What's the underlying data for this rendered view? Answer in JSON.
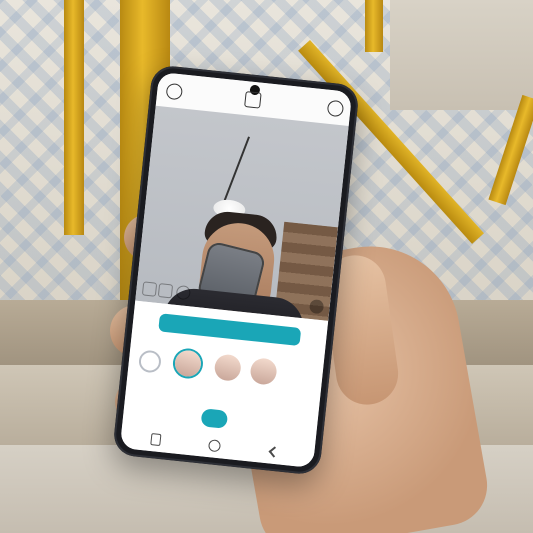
{
  "camera_ui": {
    "hint_text": "",
    "tabs": [
      "",
      "",
      "",
      ""
    ]
  },
  "colors": {
    "accent": "#1aa6b7",
    "phone_frame": "#1a1b20"
  },
  "icons": {
    "top_left": "settings-circle-icon",
    "top_center": "aspect-ratio-icon",
    "top_right": "flip-camera-icon",
    "nav_left": "recent-apps-icon",
    "nav_center": "home-icon",
    "nav_right": "back-icon"
  }
}
